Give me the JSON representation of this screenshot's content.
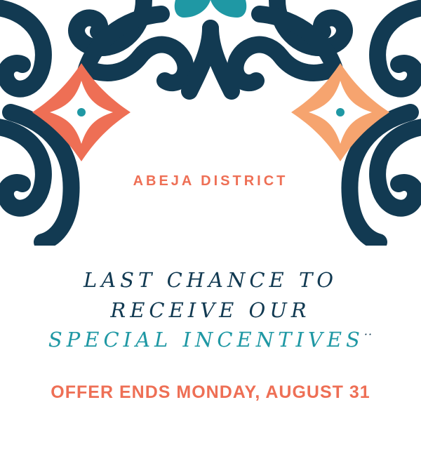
{
  "brand": {
    "name": "ABEJA DISTRICT"
  },
  "headline": {
    "line1": "LAST CHANCE TO",
    "line2": "RECEIVE OUR",
    "line3": "SPECIAL INCENTIVES",
    "line3_suffix": "··"
  },
  "offer": {
    "text": "OFFER ENDS MONDAY, AUGUST 31"
  },
  "colors": {
    "navy": "#123a52",
    "coral": "#ee6f55",
    "peach": "#f6a46f",
    "teal": "#1f98a4",
    "white": "#ffffff"
  },
  "icons": [
    "scroll-ornament-icon",
    "coral-quatrefoil-icon",
    "peach-quatrefoil-icon",
    "teal-leaf-icon"
  ]
}
